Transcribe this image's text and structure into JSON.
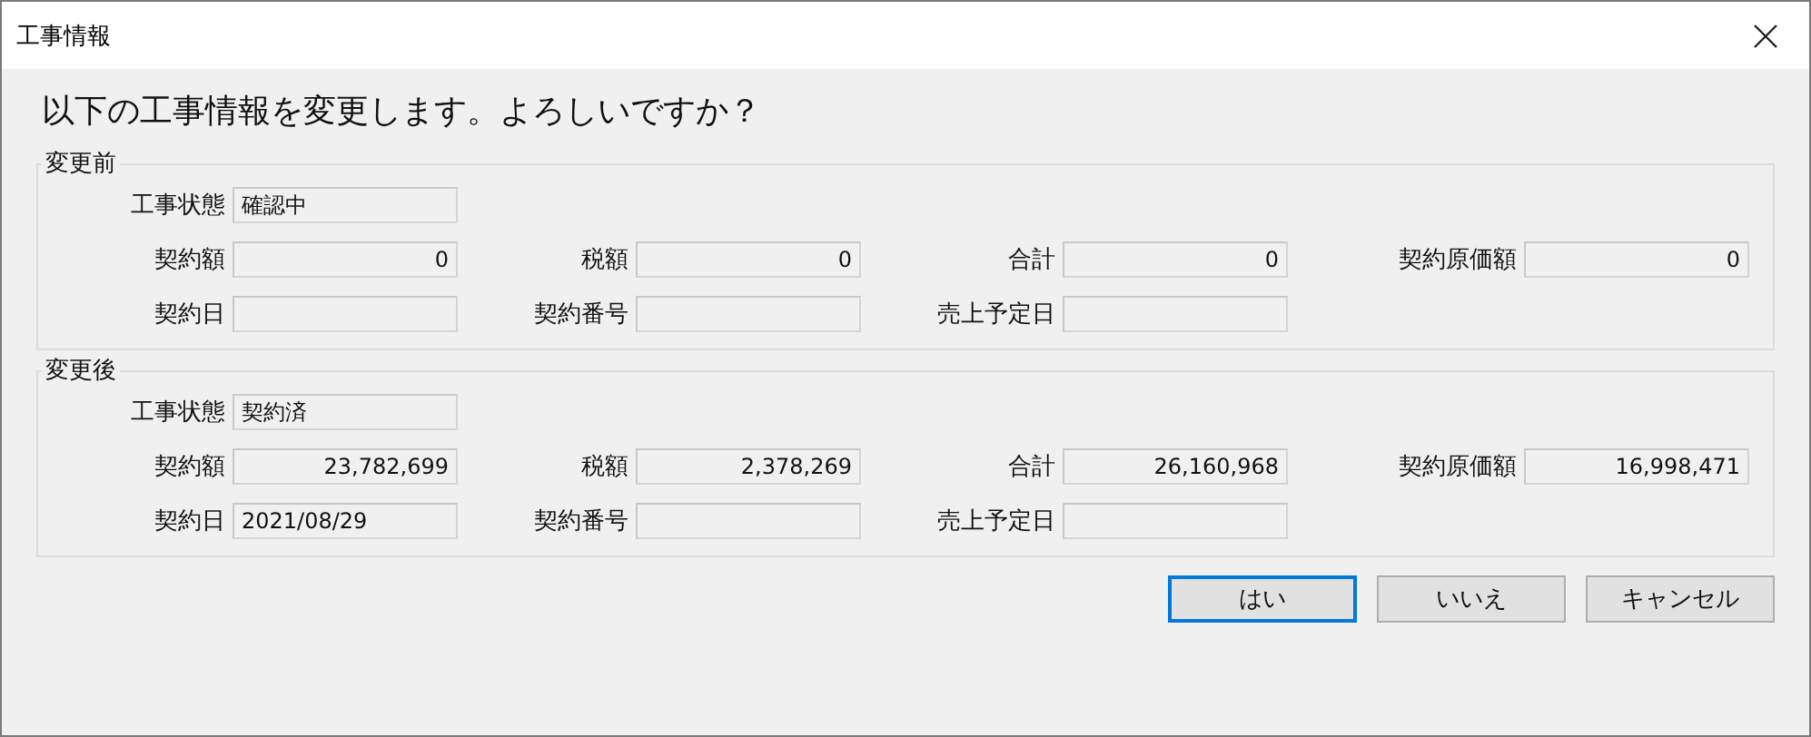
{
  "window": {
    "title": "工事情報"
  },
  "message": "以下の工事情報を変更します。よろしいですか？",
  "groups": [
    {
      "title": "変更前",
      "rows": [
        [
          {
            "label": "工事状態",
            "kind": "text",
            "value": "確認中"
          }
        ],
        [
          {
            "label": "契約額",
            "kind": "amount",
            "value": "0"
          },
          {
            "label": "税額",
            "kind": "amount",
            "value": "0"
          },
          {
            "label": "合計",
            "kind": "amount",
            "value": "0"
          },
          {
            "label": "契約原価額",
            "kind": "amount",
            "value": "0"
          }
        ],
        [
          {
            "label": "契約日",
            "kind": "text"
          },
          {
            "label": "契約番号",
            "kind": "text"
          },
          {
            "label": "売上予定日",
            "kind": "text"
          }
        ]
      ]
    },
    {
      "title": "変更後",
      "rows": [
        [
          {
            "label": "工事状態",
            "kind": "text",
            "value": "契約済"
          }
        ],
        [
          {
            "label": "契約額",
            "kind": "amount",
            "value": "23,782,699"
          },
          {
            "label": "税額",
            "kind": "amount",
            "value": "2,378,269"
          },
          {
            "label": "合計",
            "kind": "amount",
            "value": "26,160,968"
          },
          {
            "label": "契約原価額",
            "kind": "amount",
            "value": "16,998,471"
          }
        ],
        [
          {
            "label": "契約日",
            "kind": "text",
            "value": "2021/08/29"
          },
          {
            "label": "契約番号",
            "kind": "text"
          },
          {
            "label": "売上予定日",
            "kind": "text"
          }
        ]
      ]
    }
  ],
  "buttons": [
    {
      "label": "はい",
      "selected": true
    },
    {
      "label": "いいえ",
      "selected": false
    },
    {
      "label": "キャンセル",
      "selected": false
    }
  ]
}
